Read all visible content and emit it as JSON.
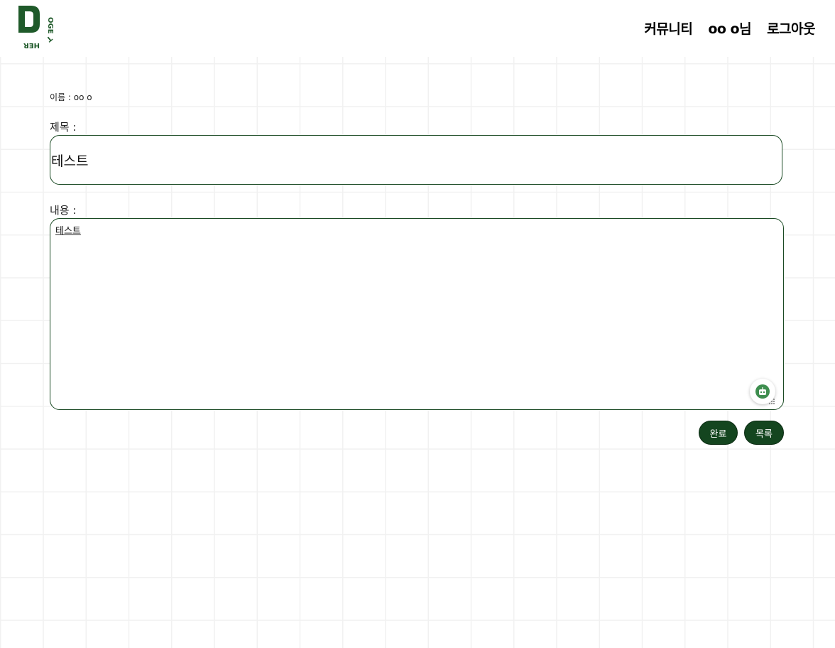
{
  "header": {
    "logo_text": "DOGETHER",
    "nav": [
      "커뮤니티",
      "oo o님",
      "로그아웃"
    ]
  },
  "form": {
    "author_label": "이름 : oo o",
    "title_label": "제목 :",
    "title_value": "테스트",
    "content_label": "내용 :",
    "content_value": "테스트"
  },
  "buttons": {
    "submit_label": "완료",
    "list_label": "목록"
  },
  "colors": {
    "brand_green": "#14451f",
    "border_green": "#1a4a23",
    "assistant_green": "#3e8e4f"
  },
  "icons": {
    "assistant": "robot-icon",
    "resize": "resize-grip-icon"
  }
}
